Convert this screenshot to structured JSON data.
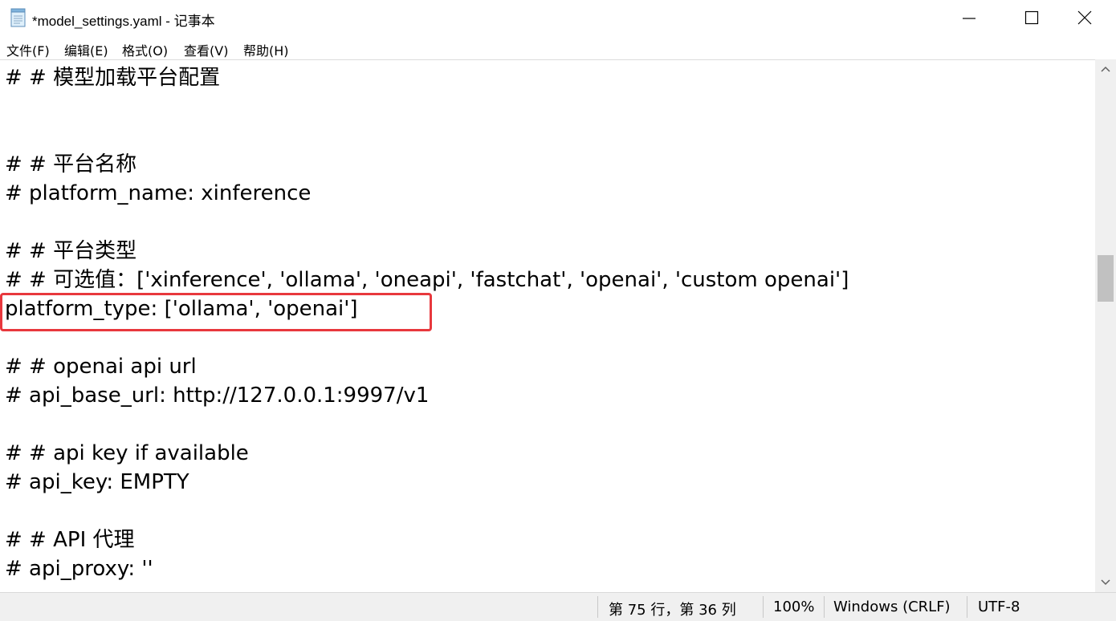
{
  "window": {
    "title": "*model_settings.yaml - 记事本"
  },
  "menu": [
    {
      "label": "文件(F)"
    },
    {
      "label": "编辑(E)"
    },
    {
      "label": "格式(O)"
    },
    {
      "label": "查看(V)"
    },
    {
      "label": "帮助(H)"
    }
  ],
  "editor": {
    "lines": [
      "# # 模型加载平台配置",
      "",
      "",
      "# # 平台名称",
      "# platform_name: xinference",
      "",
      "# # 平台类型",
      "# # 可选值：['xinference', 'ollama', 'oneapi', 'fastchat', 'openai', 'custom openai']",
      "platform_type: ['ollama', 'openai']",
      "",
      "# # openai api url",
      "# api_base_url: http://127.0.0.1:9997/v1",
      "",
      "# # api key if available",
      "# api_key: EMPTY",
      "",
      "# # API 代理",
      "# api_proxy: ''"
    ],
    "highlight_color": "#e8383d"
  },
  "status": {
    "position": "第 75 行，第 36 列",
    "zoom": "100%",
    "line_ending": "Windows (CRLF)",
    "encoding": "UTF-8"
  }
}
